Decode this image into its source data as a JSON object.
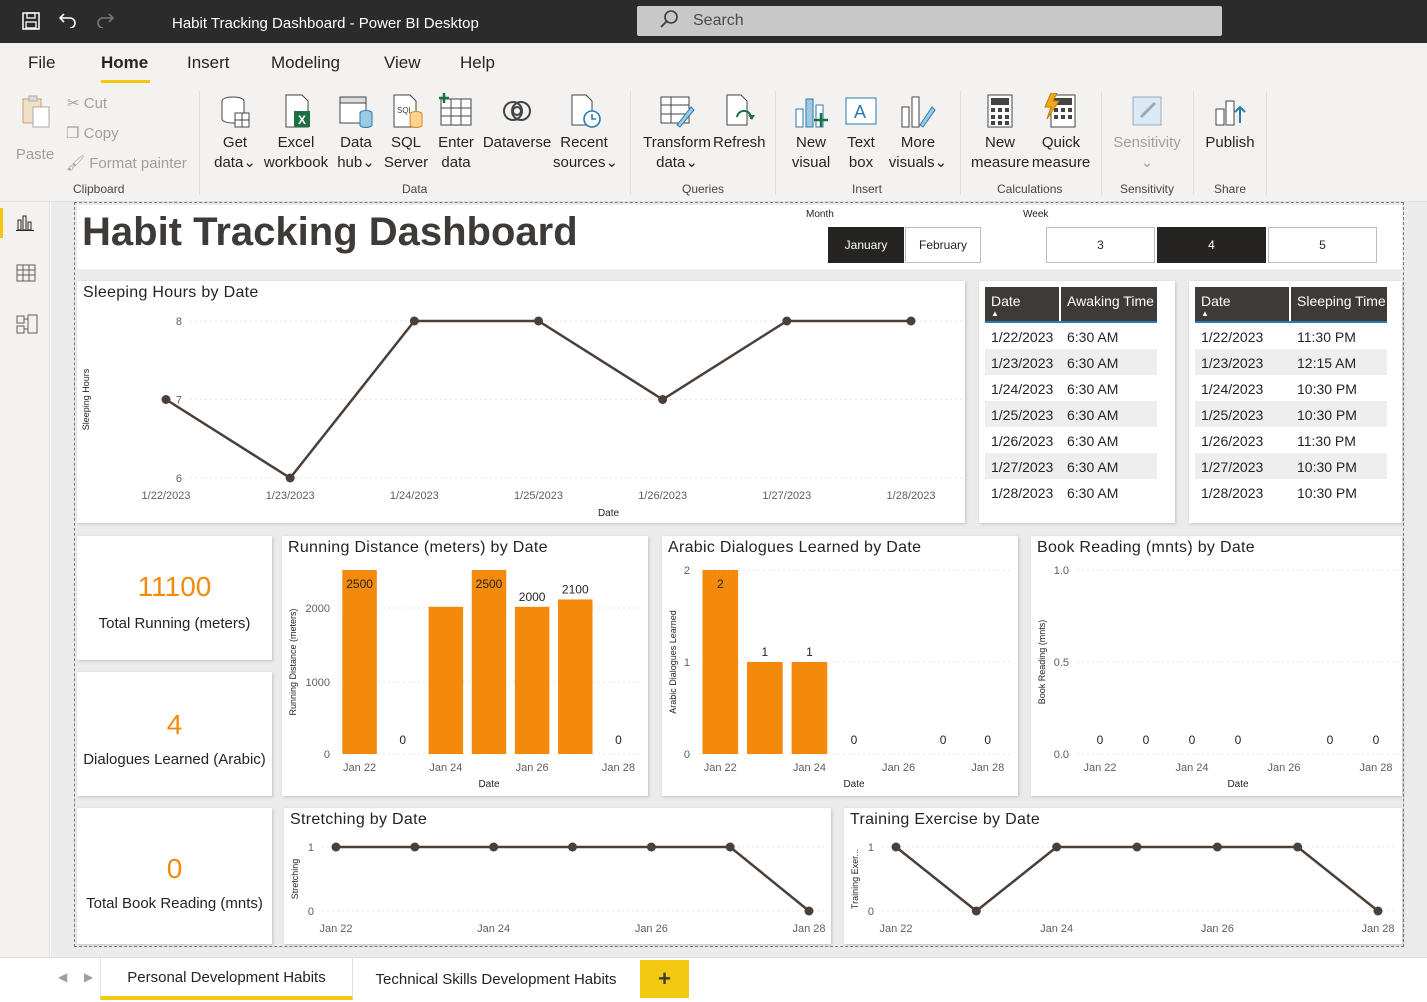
{
  "window": {
    "title": "Habit Tracking Dashboard - Power BI Desktop",
    "search_placeholder": "Search"
  },
  "menu": {
    "tabs": [
      "File",
      "Home",
      "Insert",
      "Modeling",
      "View",
      "Help"
    ],
    "active": "Home"
  },
  "ribbon": {
    "clipboard": {
      "paste": "Paste",
      "cut": "Cut",
      "copy": "Copy",
      "format_painter": "Format painter",
      "group": "Clipboard"
    },
    "data": {
      "get_data": [
        "Get",
        "data"
      ],
      "excel": [
        "Excel",
        "workbook"
      ],
      "data_hub": [
        "Data",
        "hub"
      ],
      "sql": [
        "SQL",
        "Server"
      ],
      "enter": [
        "Enter",
        "data"
      ],
      "dataverse": "Dataverse",
      "recent": [
        "Recent",
        "sources"
      ],
      "group": "Data"
    },
    "queries": {
      "transform": [
        "Transform",
        "data"
      ],
      "refresh": "Refresh",
      "group": "Queries"
    },
    "insert": {
      "new_visual": [
        "New",
        "visual"
      ],
      "text_box": [
        "Text",
        "box"
      ],
      "more_visuals": [
        "More",
        "visuals"
      ],
      "group": "Insert"
    },
    "calculations": {
      "new_measure": [
        "New",
        "measure"
      ],
      "quick_measure": [
        "Quick",
        "measure"
      ],
      "group": "Calculations"
    },
    "sensitivity": {
      "label": "Sensitivity",
      "group": "Sensitivity"
    },
    "share": {
      "publish": "Publish",
      "group": "Share"
    }
  },
  "dashboard": {
    "title": "Habit Tracking Dashboard",
    "month_slicer": {
      "label": "Month",
      "options": [
        "January",
        "February"
      ],
      "selected": "January"
    },
    "week_slicer": {
      "label": "Week",
      "options": [
        "3",
        "4",
        "5"
      ],
      "selected": "4"
    }
  },
  "awaking_table": {
    "headers": [
      "Date",
      "Awaking Time"
    ],
    "rows": [
      [
        "1/22/2023",
        "6:30 AM"
      ],
      [
        "1/23/2023",
        "6:30 AM"
      ],
      [
        "1/24/2023",
        "6:30 AM"
      ],
      [
        "1/25/2023",
        "6:30 AM"
      ],
      [
        "1/26/2023",
        "6:30 AM"
      ],
      [
        "1/27/2023",
        "6:30 AM"
      ],
      [
        "1/28/2023",
        "6:30 AM"
      ]
    ]
  },
  "sleeping_table": {
    "headers": [
      "Date",
      "Sleeping Time"
    ],
    "rows": [
      [
        "1/22/2023",
        "11:30 PM"
      ],
      [
        "1/23/2023",
        "12:15 AM"
      ],
      [
        "1/24/2023",
        "10:30 PM"
      ],
      [
        "1/25/2023",
        "10:30 PM"
      ],
      [
        "1/26/2023",
        "11:30 PM"
      ],
      [
        "1/27/2023",
        "10:30 PM"
      ],
      [
        "1/28/2023",
        "10:30 PM"
      ]
    ]
  },
  "kpis": [
    {
      "value": "11100",
      "label": "Total Running (meters)"
    },
    {
      "value": "4",
      "label": "Dialogues Learned (Arabic)"
    },
    {
      "value": "0",
      "label": "Total Book Reading (mnts)"
    }
  ],
  "colors": {
    "accent_orange": "#f38a0b",
    "line_dark": "#4a3f39",
    "header_dark": "#3d3a37",
    "powerbi_yellow": "#f2c811"
  },
  "chart_data": [
    {
      "id": "sleeping",
      "type": "line",
      "title": "Sleeping Hours by Date",
      "xlabel": "Date",
      "ylabel": "Sleeping Hours",
      "x": [
        "1/22/2023",
        "1/23/2023",
        "1/24/2023",
        "1/25/2023",
        "1/26/2023",
        "1/27/2023",
        "1/28/2023"
      ],
      "values": [
        7,
        6,
        8,
        8,
        7,
        8,
        8
      ],
      "ylim": [
        6,
        8
      ],
      "yticks": [
        "8",
        "7",
        "6"
      ]
    },
    {
      "id": "running",
      "type": "bar",
      "title": "Running Distance (meters) by Date",
      "xlabel": "Date",
      "ylabel": "Running Distance (meters)",
      "x": [
        "Jan 22",
        "Jan 23",
        "Jan 24",
        "Jan 25",
        "Jan 26",
        "Jan 27",
        "Jan 28"
      ],
      "xticks": [
        "Jan 22",
        "Jan 24",
        "Jan 26",
        "Jan 28"
      ],
      "values": [
        2500,
        0,
        2000,
        2500,
        2000,
        2100,
        0
      ],
      "labels": [
        "2500",
        "0",
        "",
        "2500",
        "2000",
        "2100",
        "0"
      ],
      "ylim": [
        0,
        2500
      ],
      "yticks": [
        "2000",
        "1000",
        "0"
      ]
    },
    {
      "id": "arabic",
      "type": "bar",
      "title": "Arabic Dialogues Learned by Date",
      "xlabel": "Date",
      "ylabel": "Arabic Dialogues Learned",
      "x": [
        "Jan 22",
        "Jan 23",
        "Jan 24",
        "Jan 25",
        "Jan 26",
        "Jan 27",
        "Jan 28"
      ],
      "xticks": [
        "Jan 22",
        "Jan 24",
        "Jan 26",
        "Jan 28"
      ],
      "values": [
        2,
        1,
        1,
        0,
        0,
        0,
        0
      ],
      "labels": [
        "2",
        "1",
        "1",
        "0",
        "",
        "0",
        "0"
      ],
      "ylim": [
        0,
        2
      ],
      "yticks": [
        "2",
        "1",
        "0"
      ]
    },
    {
      "id": "book",
      "type": "bar",
      "title": "Book Reading (mnts) by Date",
      "xlabel": "Date",
      "ylabel": "Book Reading (mnts)",
      "x": [
        "Jan 22",
        "Jan 23",
        "Jan 24",
        "Jan 25",
        "Jan 26",
        "Jan 27",
        "Jan 28"
      ],
      "xticks": [
        "Jan 22",
        "Jan 24",
        "Jan 26",
        "Jan 28"
      ],
      "values": [
        0,
        0,
        0,
        0,
        0,
        0,
        0
      ],
      "labels": [
        "0",
        "0",
        "0",
        "0",
        "",
        "0",
        "0"
      ],
      "ylim": [
        0,
        1
      ],
      "yticks": [
        "1.0",
        "0.5",
        "0.0"
      ]
    },
    {
      "id": "stretching",
      "type": "line",
      "title": "Stretching by Date",
      "xlabel": "",
      "ylabel": "Stretching",
      "x": [
        "Jan 22",
        "Jan 23",
        "Jan 24",
        "Jan 25",
        "Jan 26",
        "Jan 27",
        "Jan 28"
      ],
      "xticks": [
        "Jan 22",
        "Jan 24",
        "Jan 26",
        "Jan 28"
      ],
      "values": [
        1,
        1,
        1,
        1,
        1,
        1,
        0
      ],
      "ylim": [
        0,
        1
      ],
      "yticks": [
        "1",
        "0"
      ]
    },
    {
      "id": "training",
      "type": "line",
      "title": "Training Exercise by Date",
      "xlabel": "",
      "ylabel": "Training Exer...",
      "x": [
        "Jan 22",
        "Jan 23",
        "Jan 24",
        "Jan 25",
        "Jan 26",
        "Jan 27",
        "Jan 28"
      ],
      "xticks": [
        "Jan 22",
        "Jan 24",
        "Jan 26",
        "Jan 28"
      ],
      "values": [
        1,
        0,
        1,
        1,
        1,
        1,
        0
      ],
      "ylim": [
        0,
        1
      ],
      "yticks": [
        "1",
        "0"
      ]
    }
  ],
  "pages": {
    "tabs": [
      "Personal Development Habits",
      "Technical Skills Development Habits"
    ],
    "active": "Personal Development Habits",
    "add": "+"
  }
}
